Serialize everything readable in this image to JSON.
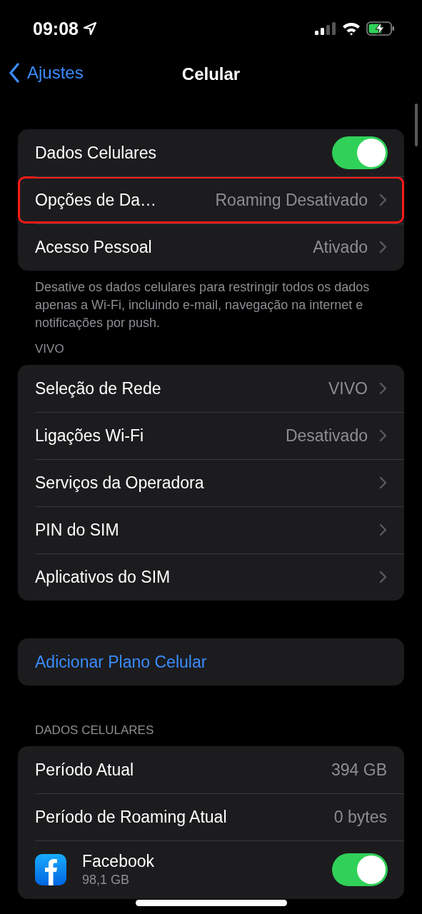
{
  "status_bar": {
    "time": "09:08"
  },
  "nav": {
    "back": "Ajustes",
    "title": "Celular"
  },
  "sections": [
    {
      "items": [
        {
          "kind": "toggle",
          "label": "Dados Celulares",
          "on": true,
          "highlighted": false
        },
        {
          "kind": "link",
          "label": "Opções de Da…",
          "value": "Roaming Desativado",
          "highlighted": true
        },
        {
          "kind": "link",
          "label": "Acesso Pessoal",
          "value": "Ativado",
          "highlighted": false
        }
      ],
      "footer": "Desative os dados celulares para restringir todos os dados apenas a Wi-Fi, incluindo e-mail, navegação na internet e notificações por push."
    },
    {
      "header": "VIVO",
      "items": [
        {
          "kind": "link",
          "label": "Seleção de Rede",
          "value": "VIVO",
          "highlighted": false
        },
        {
          "kind": "link",
          "label": "Ligações Wi-Fi",
          "value": "Desativado",
          "highlighted": false
        },
        {
          "kind": "link",
          "label": "Serviços da Operadora",
          "highlighted": false
        },
        {
          "kind": "link",
          "label": "PIN do SIM",
          "highlighted": false
        },
        {
          "kind": "link",
          "label": "Aplicativos do SIM",
          "highlighted": false
        }
      ]
    },
    {
      "items": [
        {
          "kind": "action",
          "label": "Adicionar Plano Celular",
          "highlighted": false
        }
      ]
    },
    {
      "header": "DADOS CELULARES",
      "items": [
        {
          "kind": "usage",
          "label": "Período Atual",
          "value": "394 GB",
          "highlighted": false
        },
        {
          "kind": "usage",
          "label": "Período de Roaming Atual",
          "value": "0 bytes",
          "highlighted": false
        },
        {
          "kind": "app",
          "label": "Facebook",
          "subtitle": "98,1 GB",
          "on": true,
          "highlighted": false
        }
      ]
    }
  ]
}
